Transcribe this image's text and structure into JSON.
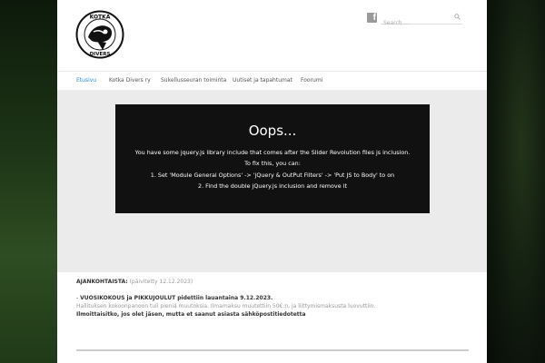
{
  "header": {
    "logo_text_top": "KOTKA",
    "logo_text_bottom": "DIVERS",
    "facebook_glyph": "f",
    "search_placeholder": "Search ..."
  },
  "nav": {
    "items": [
      {
        "label": "Etusivu",
        "active": true
      },
      {
        "label": "Kotka Divers ry",
        "active": false
      },
      {
        "label": "Sukellusseuran toiminta",
        "active": false
      },
      {
        "label": "Uutiset ja tapahtumat",
        "active": false
      },
      {
        "label": "Foorumi",
        "active": false
      }
    ]
  },
  "error_box": {
    "title": "Oops...",
    "lines": [
      "You have some jquery.js library include that comes after the Slider Revolution files js inclusion.",
      "To fix this, you can:",
      "1. Set 'Module General Options' -> 'jQuery & OutPut Filters' -> 'Put JS to Body' to on",
      "2. Find the double jQuery.js inclusion and remove it"
    ]
  },
  "news": {
    "heading": "AJANKOHTAISTA:",
    "updated": "(päivitetty 12.12.2023)",
    "prefix": "- ",
    "event": "VUOSIKOKOUS ja PIKKUJOULUT pidettiin lauantaina 9.12.2023.",
    "detail": "Hallituksen kokoonpanoon tuli pieniä muutoksia. Ilmamaksu muutettiin 50€:n, ja liittymismaksusta luovuttiin.",
    "notice": "Ilmoittaisitko, jos olet jäsen, mutta et saanut asiasta sähköpostitiedotetta"
  },
  "colors": {
    "accent": "#2b8fd1",
    "error_bg": "#111111",
    "content_bg": "#ebebeb"
  }
}
